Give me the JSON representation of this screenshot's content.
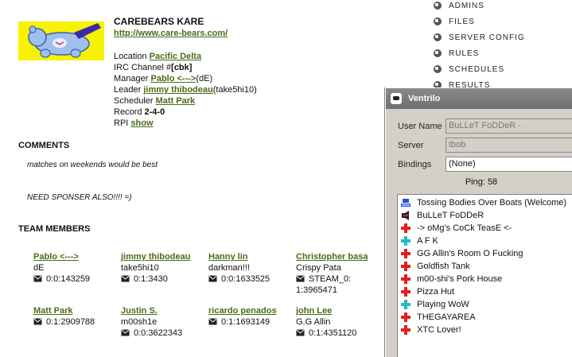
{
  "team": {
    "name": "CAREBEARS KARE",
    "url": "http://www.care-bears.com/",
    "location_label": "Location",
    "location": "Pacific Delta",
    "irc_label": "IRC Channel #",
    "irc": "[cbk]",
    "manager_label": "Manager",
    "manager": "Pablo <--->",
    "manager_suffix": "(dE)",
    "leader_label": "Leader",
    "leader": "jimmy thibodeau",
    "leader_suffix": "(take5hi10)",
    "scheduler_label": "Scheduler",
    "scheduler": "Matt Park",
    "record_label": "Record",
    "record": "2-4-0",
    "rpi_label": "RPI",
    "rpi": "show"
  },
  "comments": {
    "title": "COMMENTS",
    "line1": "matches on weekends would be best",
    "line2": "NEED SPONSER ALSO!!!! =)"
  },
  "members_title": "TEAM MEMBERS",
  "members": [
    {
      "name": "Pablo <--->",
      "alias": "dE",
      "id": "0:0:143259"
    },
    {
      "name": "jimmy thibodeau",
      "alias": "take5hi10",
      "id": "0:1:3430"
    },
    {
      "name": "Hanny lin",
      "alias": "darkman!!!",
      "id": "0:0:1633525"
    },
    {
      "name": "Christopher basa",
      "alias": "Crispy Pata",
      "id": "STEAM_0:",
      "id2": "1:3965471"
    },
    {
      "name": "Matt Park",
      "alias": "",
      "id": "0:1:2909788"
    },
    {
      "name": "Justin S.",
      "alias": "m00sh1e",
      "id": "0:0:3622343"
    },
    {
      "name": "ricardo penados",
      "alias": "",
      "id": "0:1:1693149"
    },
    {
      "name": "john Lee",
      "alias": "G.G Allin",
      "id": "0:1:4351120"
    }
  ],
  "menu": [
    "ADMINS",
    "FILES",
    "SERVER CONFIG",
    "RULES",
    "SCHEDULES",
    "RESULTS"
  ],
  "ventrilo": {
    "title": "Ventrilo",
    "user_name_label": "User Name",
    "user_name": "BuLLeT FoDDeR -",
    "server_label": "Server",
    "server": "tbob",
    "bindings_label": "Bindings",
    "bindings": "(None)",
    "ping": "Ping: 58",
    "channels": [
      {
        "label": "Tossing Bodies Over Boats (Welcome)",
        "icon": "server-icon"
      },
      {
        "label": "BuLLeT FoDDeR",
        "icon": "speaker-icon"
      },
      {
        "label": "-> oMg's CoCk TeasE <-",
        "icon": "red-cross-icon"
      },
      {
        "label": "A F K",
        "icon": "cyan-cross-icon"
      },
      {
        "label": "GG Allin's Room O Fucking",
        "icon": "red-cross-icon"
      },
      {
        "label": "Goldfish Tank",
        "icon": "red-cross-icon"
      },
      {
        "label": "m00-shi's Pork House",
        "icon": "red-cross-icon"
      },
      {
        "label": "Pizza Hut",
        "icon": "red-cross-icon"
      },
      {
        "label": "Playing WoW",
        "icon": "cyan-cross-icon"
      },
      {
        "label": "THEGAYAREA",
        "icon": "red-cross-icon"
      },
      {
        "label": "XTC Lover!",
        "icon": "red-cross-icon"
      }
    ]
  },
  "colors": {
    "link": "#4a6b1a",
    "logo_bg": "#f7f200",
    "cross_red": "#e02020",
    "cross_cyan": "#26b7c9"
  }
}
